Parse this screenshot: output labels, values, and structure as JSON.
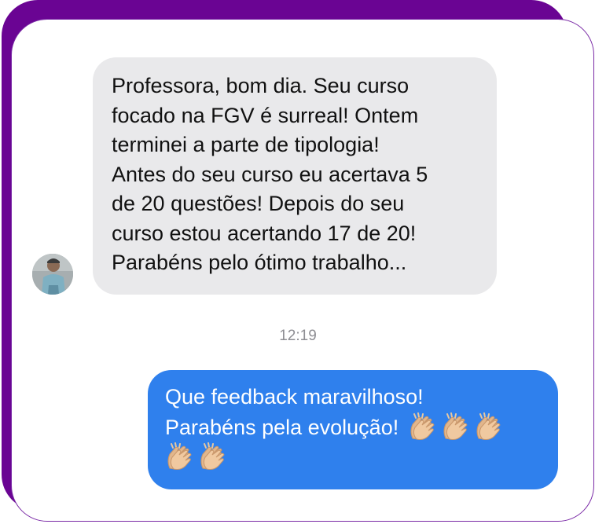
{
  "conversation": {
    "incoming": {
      "text": "Professora, bom dia. Seu curso\nfocado na FGV é surreal! Ontem\nterminei a parte de tipologia!\nAntes do seu curso eu acertava 5\nde 20 questões! Depois do seu\ncurso estou acertando 17 de 20!\nParabéns pelo ótimo trabalho..."
    },
    "timestamp": "12:19",
    "outgoing": {
      "line1": "Que feedback maravilhoso!",
      "line2": "Parabéns pela evolução!",
      "emoji_icon": "clapping-hands-icon",
      "emoji_count": 5
    }
  },
  "colors": {
    "frame_purple": "#6a0493",
    "incoming_bubble": "#e9e9eb",
    "outgoing_bubble": "#2f80ed",
    "timestamp_text": "#8e8e93"
  }
}
